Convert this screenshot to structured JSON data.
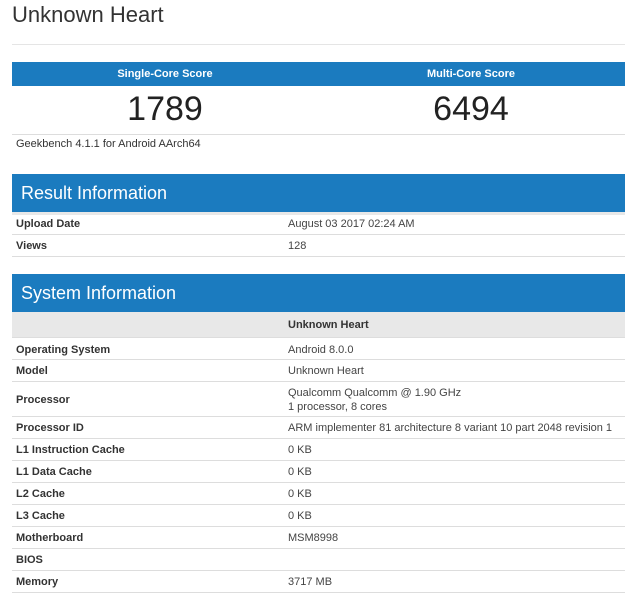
{
  "page": {
    "title": "Unknown Heart"
  },
  "scores": {
    "single_label": "Single-Core Score",
    "multi_label": "Multi-Core Score",
    "single_value": "1789",
    "multi_value": "6494",
    "version": "Geekbench 4.1.1 for Android AArch64"
  },
  "result_info": {
    "title": "Result Information",
    "rows": [
      {
        "key": "Upload Date",
        "value": "August 03 2017 02:24 AM"
      },
      {
        "key": "Views",
        "value": "128"
      }
    ]
  },
  "system_info": {
    "title": "System Information",
    "subheader": "Unknown Heart",
    "rows": [
      {
        "key": "Operating System",
        "value": "Android 8.0.0"
      },
      {
        "key": "Model",
        "value": "Unknown Heart"
      },
      {
        "key": "Processor",
        "value": "Qualcomm Qualcomm @ 1.90 GHz",
        "value2": "1 processor, 8 cores"
      },
      {
        "key": "Processor ID",
        "value": "ARM implementer 81 architecture 8 variant 10 part 2048 revision 1"
      },
      {
        "key": "L1 Instruction Cache",
        "value": "0 KB"
      },
      {
        "key": "L1 Data Cache",
        "value": "0 KB"
      },
      {
        "key": "L2 Cache",
        "value": "0 KB"
      },
      {
        "key": "L3 Cache",
        "value": "0 KB"
      },
      {
        "key": "Motherboard",
        "value": "MSM8998"
      },
      {
        "key": "BIOS",
        "value": ""
      },
      {
        "key": "Memory",
        "value": "3717 MB"
      }
    ]
  }
}
